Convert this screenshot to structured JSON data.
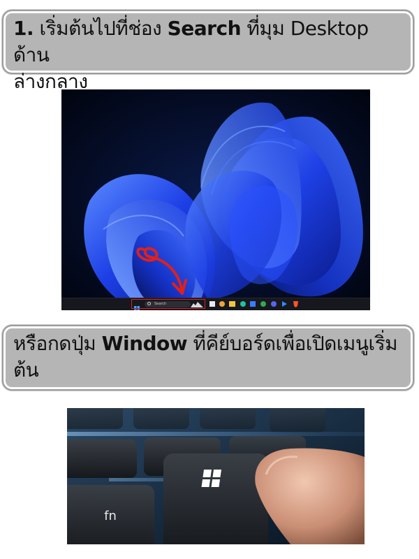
{
  "step1": {
    "number": "1.",
    "text_before": " เริ่มต้นไปที่ช่อง ",
    "keyword": "Search",
    "text_after": " ที่มุม Desktop ด้าน",
    "text_line2": "ล่างกลาง"
  },
  "screenshot": {
    "search_label": "Search"
  },
  "step2": {
    "text_before": "หรือกดปุ่ม ",
    "keyword": "Window",
    "text_after": " ที่คีย์บอร์ดเพื่อเปิดเมนูเริ่ม",
    "text_line2": "ต้น"
  },
  "colors": {
    "box_fill": "#b5b5b5",
    "highlight_red": "#e0201b",
    "wallpaper_blue": "#1e4cff"
  }
}
